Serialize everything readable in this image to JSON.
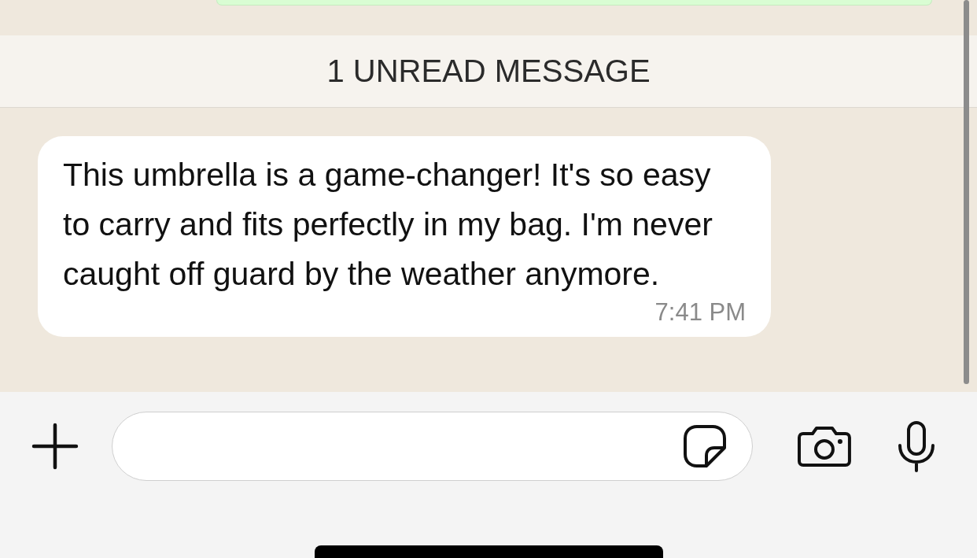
{
  "unread_banner": {
    "text": "1 UNREAD MESSAGE"
  },
  "message": {
    "text": "This umbrella is a game-changer! It's so easy to carry and fits perfectly in my bag. I'm never caught off guard by the weather anymore.",
    "time": "7:41 PM"
  }
}
